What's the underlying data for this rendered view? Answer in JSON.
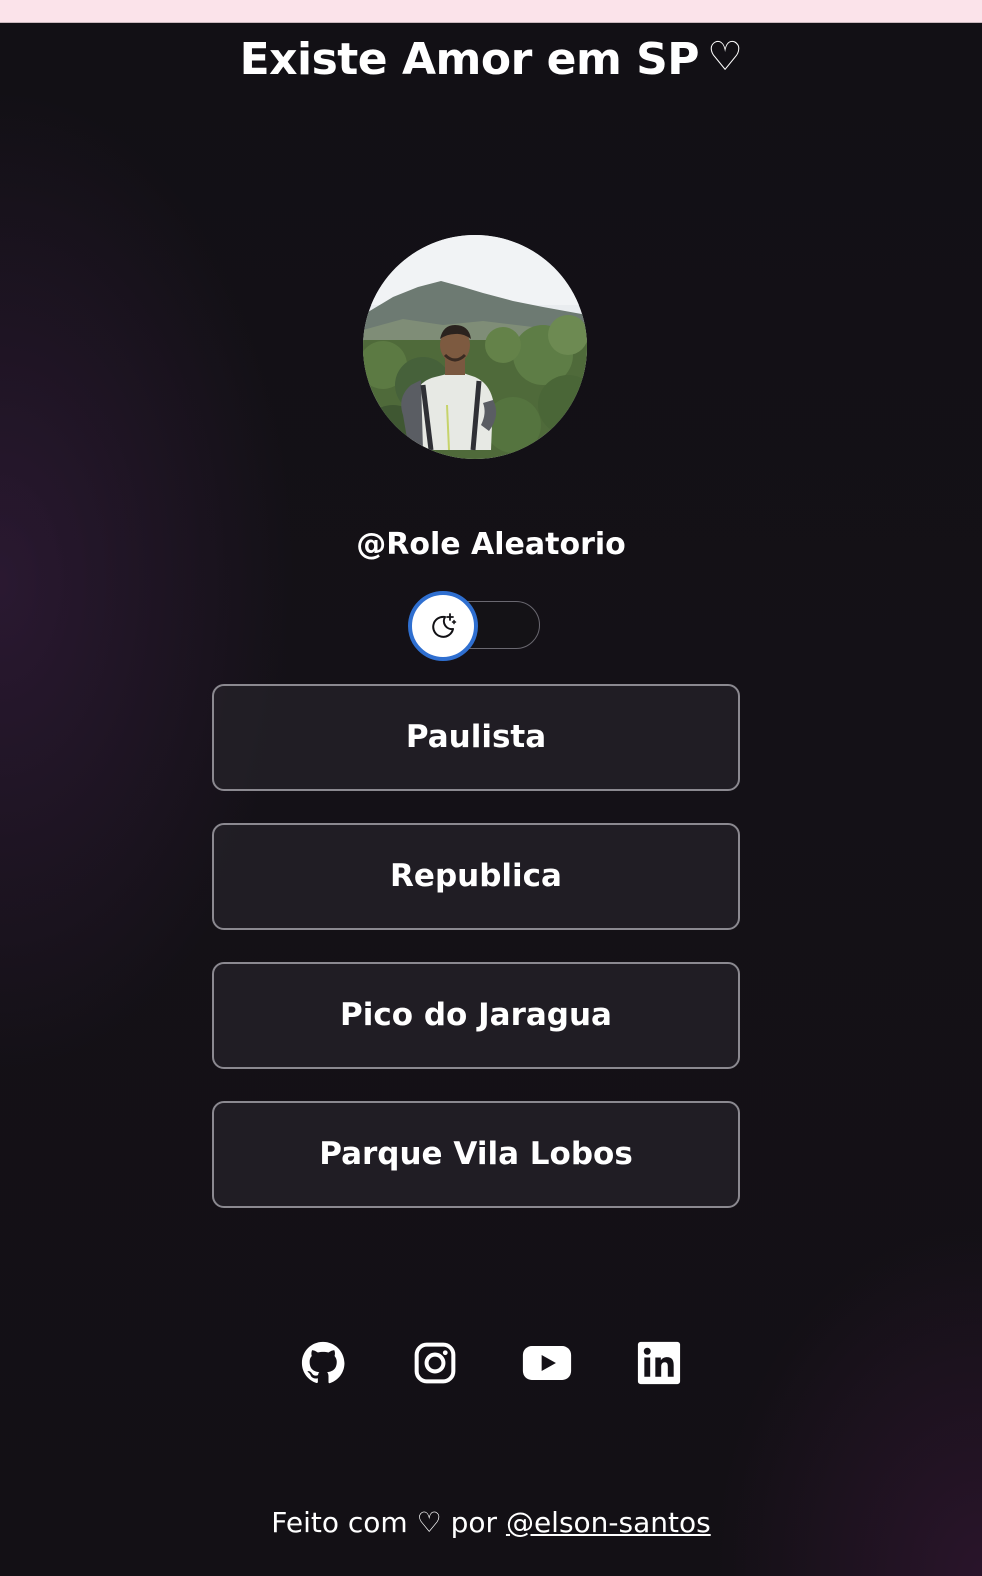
{
  "header": {
    "title": "Existe Amor em SP",
    "title_heart": "♡"
  },
  "profile": {
    "handle": "@Role Aleatorio",
    "avatar_icon": "profile-photo"
  },
  "theme_switch": {
    "icon": "moon-stars-icon",
    "accent": "#2f6fd0"
  },
  "links": [
    {
      "label": "Paulista"
    },
    {
      "label": "Republica"
    },
    {
      "label": "Pico do Jaragua"
    },
    {
      "label": "Parque Vila Lobos"
    }
  ],
  "socials": [
    {
      "icon": "github-icon"
    },
    {
      "icon": "instagram-icon"
    },
    {
      "icon": "youtube-icon"
    },
    {
      "icon": "linkedin-icon"
    }
  ],
  "footer": {
    "prefix": "Feito com",
    "heart": "♡",
    "middle": "por",
    "author": "@elson-santos"
  },
  "colors": {
    "background": "#121015",
    "top_bar": "#fbe3ea",
    "button_border": "#8b8990",
    "text": "#ffffff"
  }
}
